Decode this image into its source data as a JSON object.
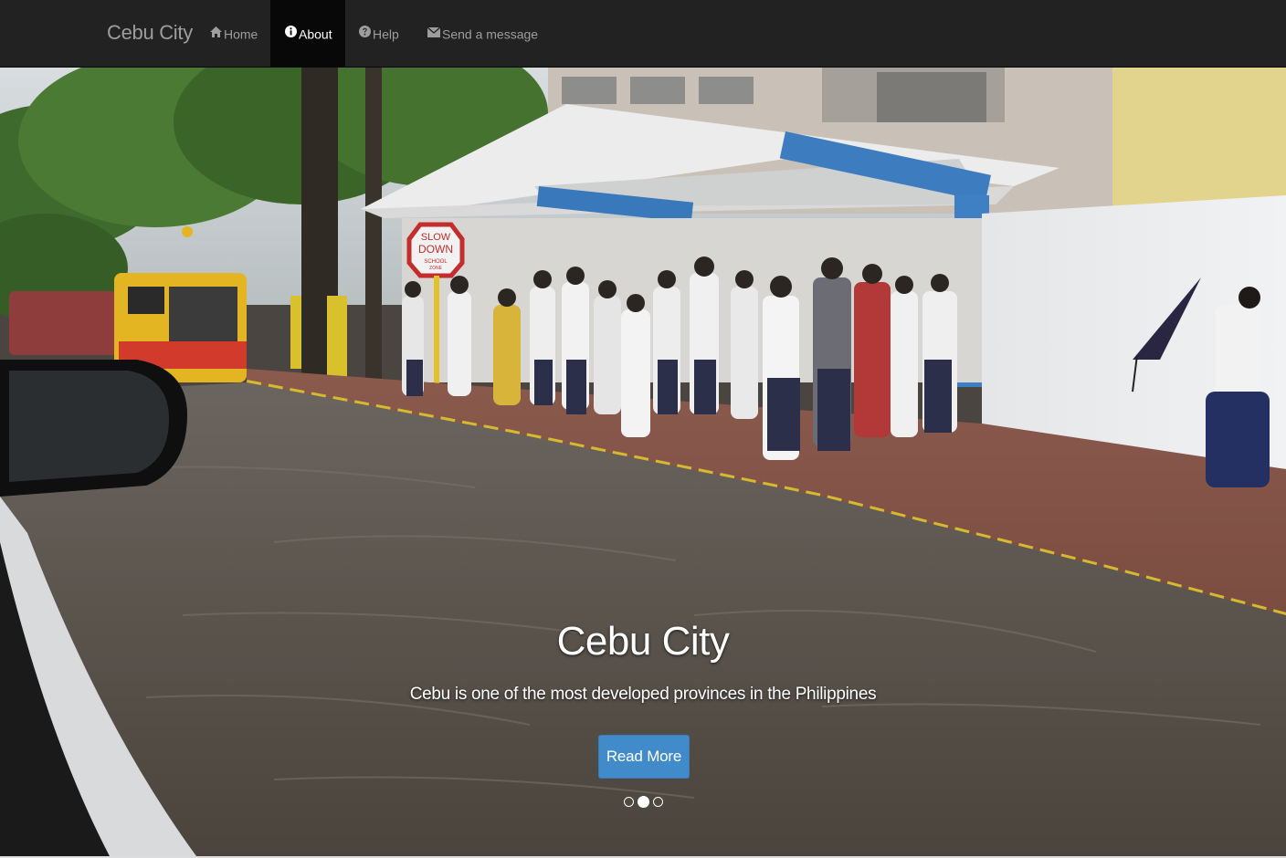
{
  "navbar": {
    "brand": "Cebu City",
    "items": [
      {
        "label": "Home",
        "icon": "home-icon",
        "active": false
      },
      {
        "label": "About",
        "icon": "info-icon",
        "active": true
      },
      {
        "label": "Help",
        "icon": "question-icon",
        "active": false
      },
      {
        "label": "Send a message",
        "icon": "envelope-icon",
        "active": false
      }
    ]
  },
  "carousel": {
    "title": "Cebu City",
    "text": "Cebu is one of the most developed provinces in the Philippines",
    "button_label": "Read More",
    "slide_count": 3,
    "active_index": 1,
    "sign_text": [
      "SLOW",
      "DOWN",
      "SCHOOL",
      "ZONE"
    ]
  },
  "colors": {
    "navbar_bg": "#222222",
    "nav_active_bg": "#080808",
    "nav_text": "#9d9d9d",
    "button_bg": "#428bca"
  }
}
